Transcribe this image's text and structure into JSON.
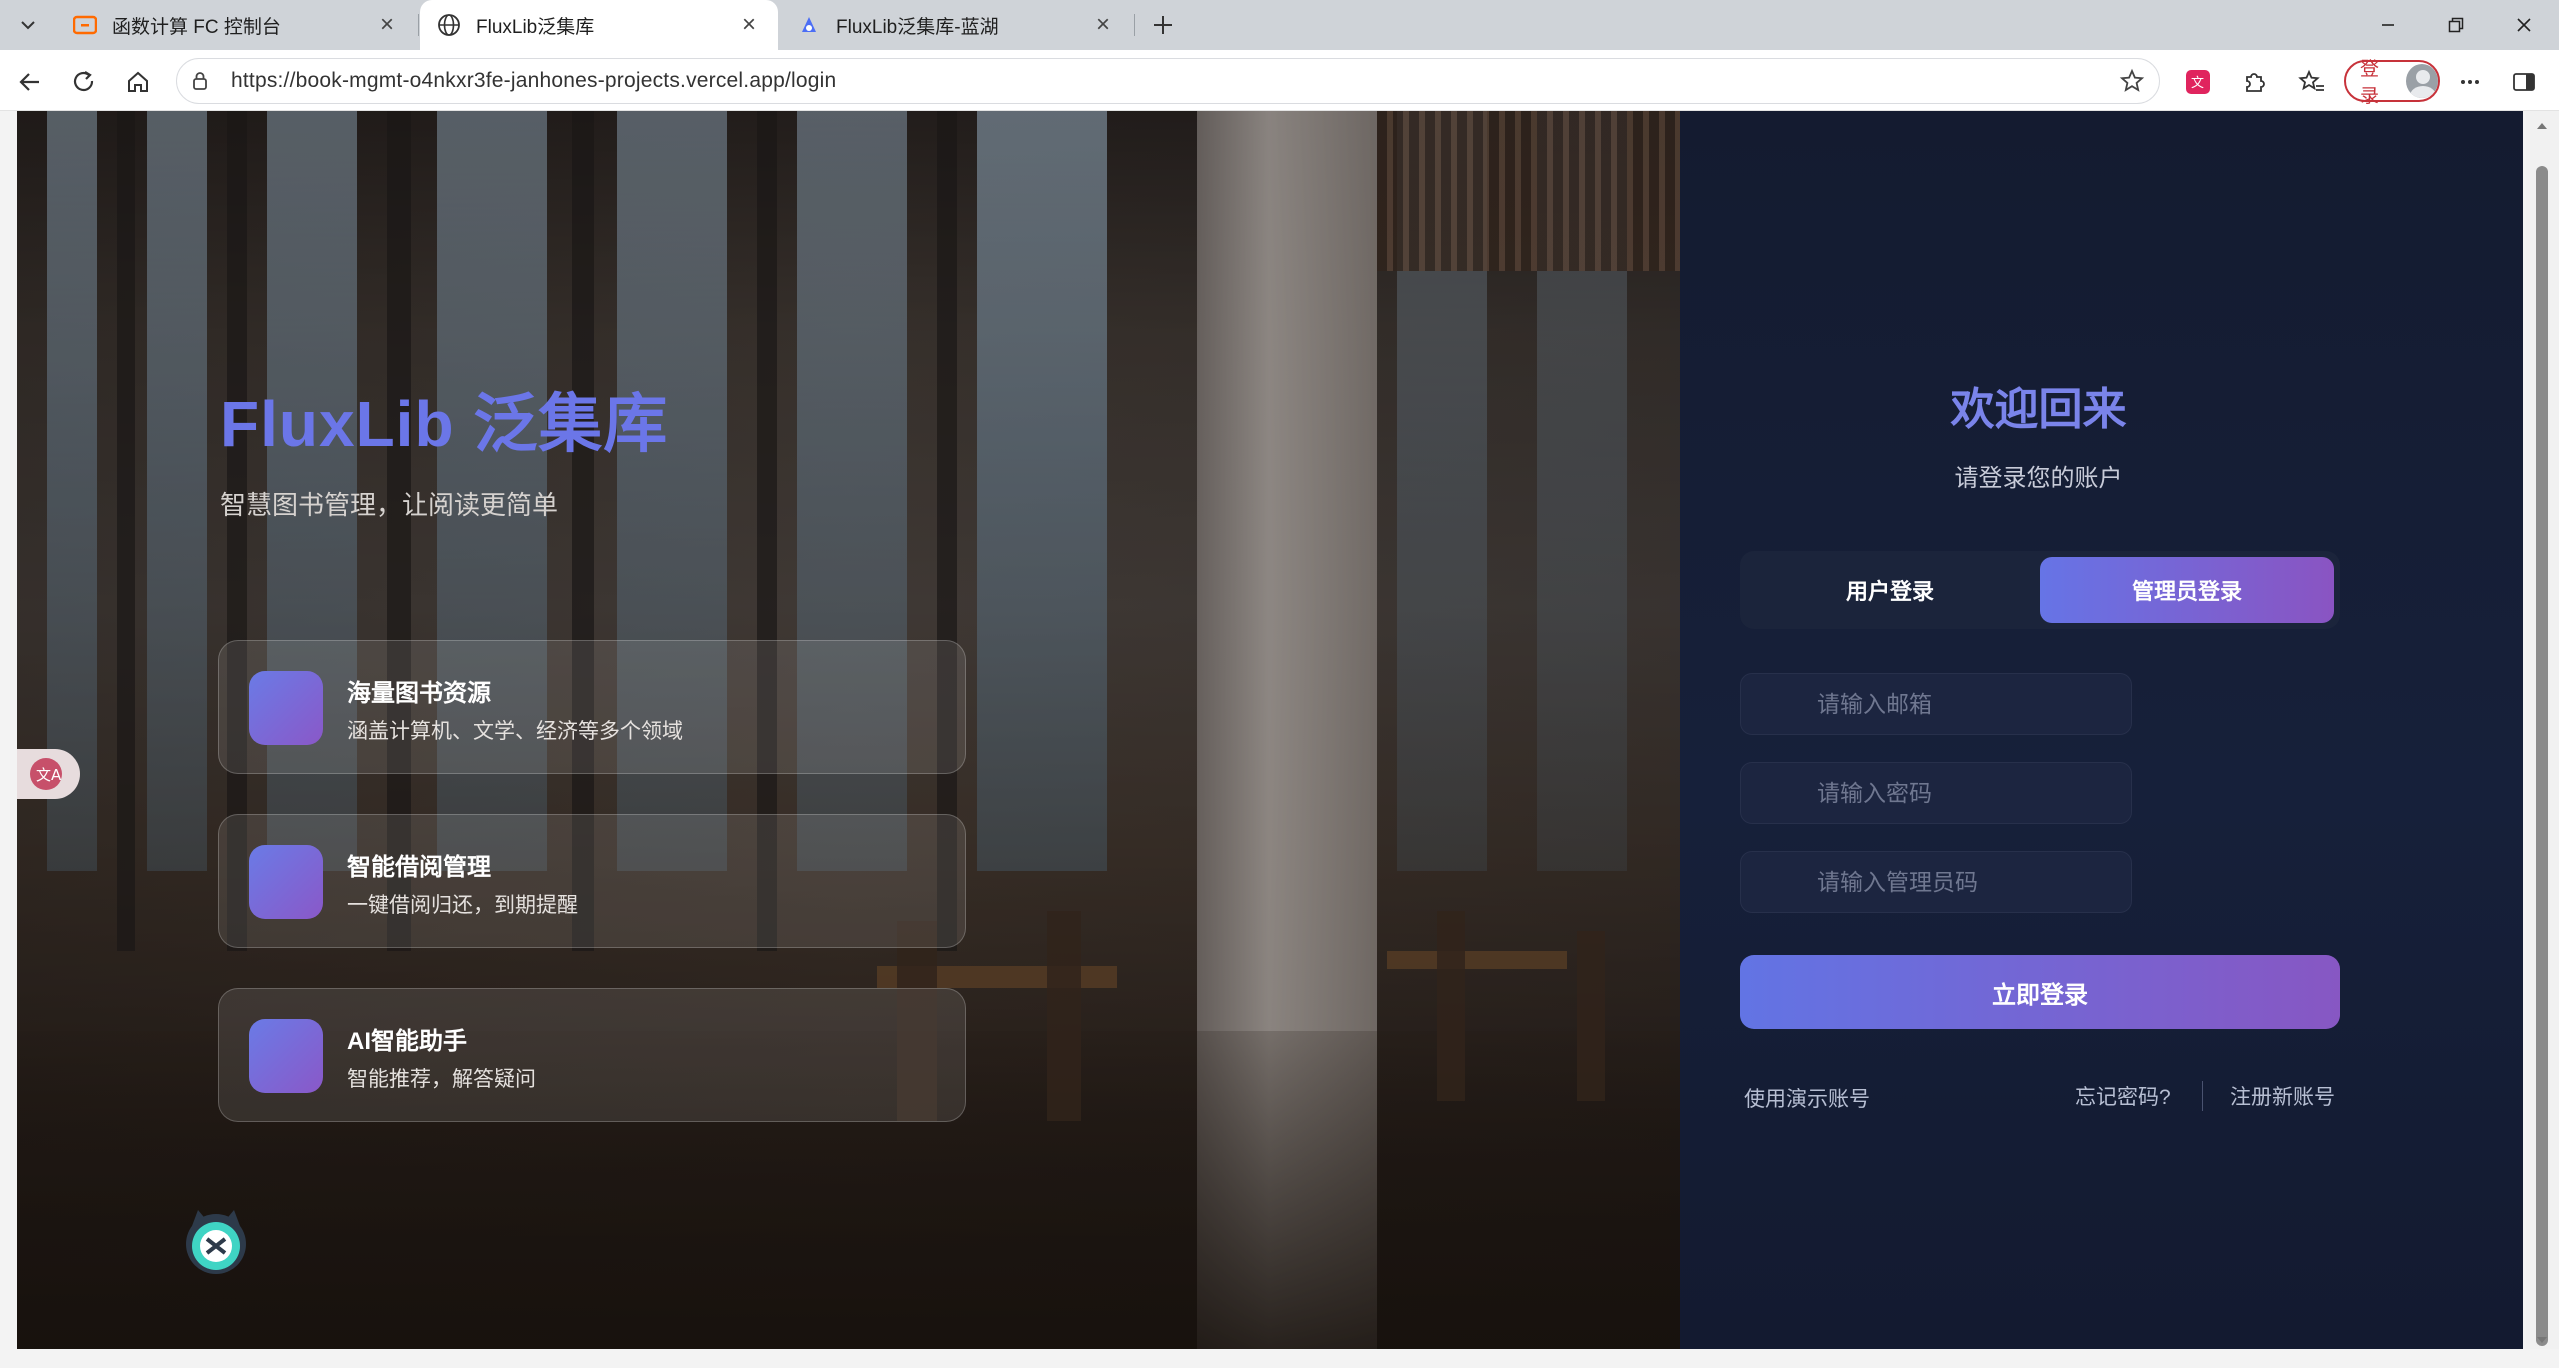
{
  "browser": {
    "tabs": [
      {
        "title": "函数计算 FC 控制台",
        "favicon": "aliyun-icon",
        "active": false
      },
      {
        "title": "FluxLib泛集库",
        "favicon": "globe-icon",
        "active": true
      },
      {
        "title": "FluxLib泛集库-蓝湖",
        "favicon": "lanhu-icon",
        "active": false
      }
    ],
    "url": "https://book-mgmt-o4nkxr3fe-janhones-projects.vercel.app/login",
    "profile_button_label": "登录"
  },
  "hero": {
    "title": "FluxLib 泛集库",
    "subtitle": "智慧图书管理，让阅读更简单",
    "features": [
      {
        "title": "海量图书资源",
        "desc": "涵盖计算机、文学、经济等多个领域"
      },
      {
        "title": "智能借阅管理",
        "desc": "一键借阅归还，到期提醒"
      },
      {
        "title": "AI智能助手",
        "desc": "智能推荐，解答疑问"
      }
    ]
  },
  "login": {
    "welcome": "欢迎回来",
    "welcome_sub": "请登录您的账户",
    "tabs": {
      "user": "用户登录",
      "admin": "管理员登录",
      "selected": "admin"
    },
    "email_placeholder": "请输入邮箱",
    "password_placeholder": "请输入密码",
    "admin_code_placeholder": "请输入管理员码",
    "submit_label": "立即登录",
    "demo_link": "使用演示账号",
    "forgot_link": "忘记密码?",
    "register_link": "注册新账号"
  },
  "colors": {
    "brand_title": "#6b76e8",
    "accent_gradient_start": "#6274e4",
    "accent_gradient_end": "#8757c3",
    "panel_bg": "#141b30"
  }
}
